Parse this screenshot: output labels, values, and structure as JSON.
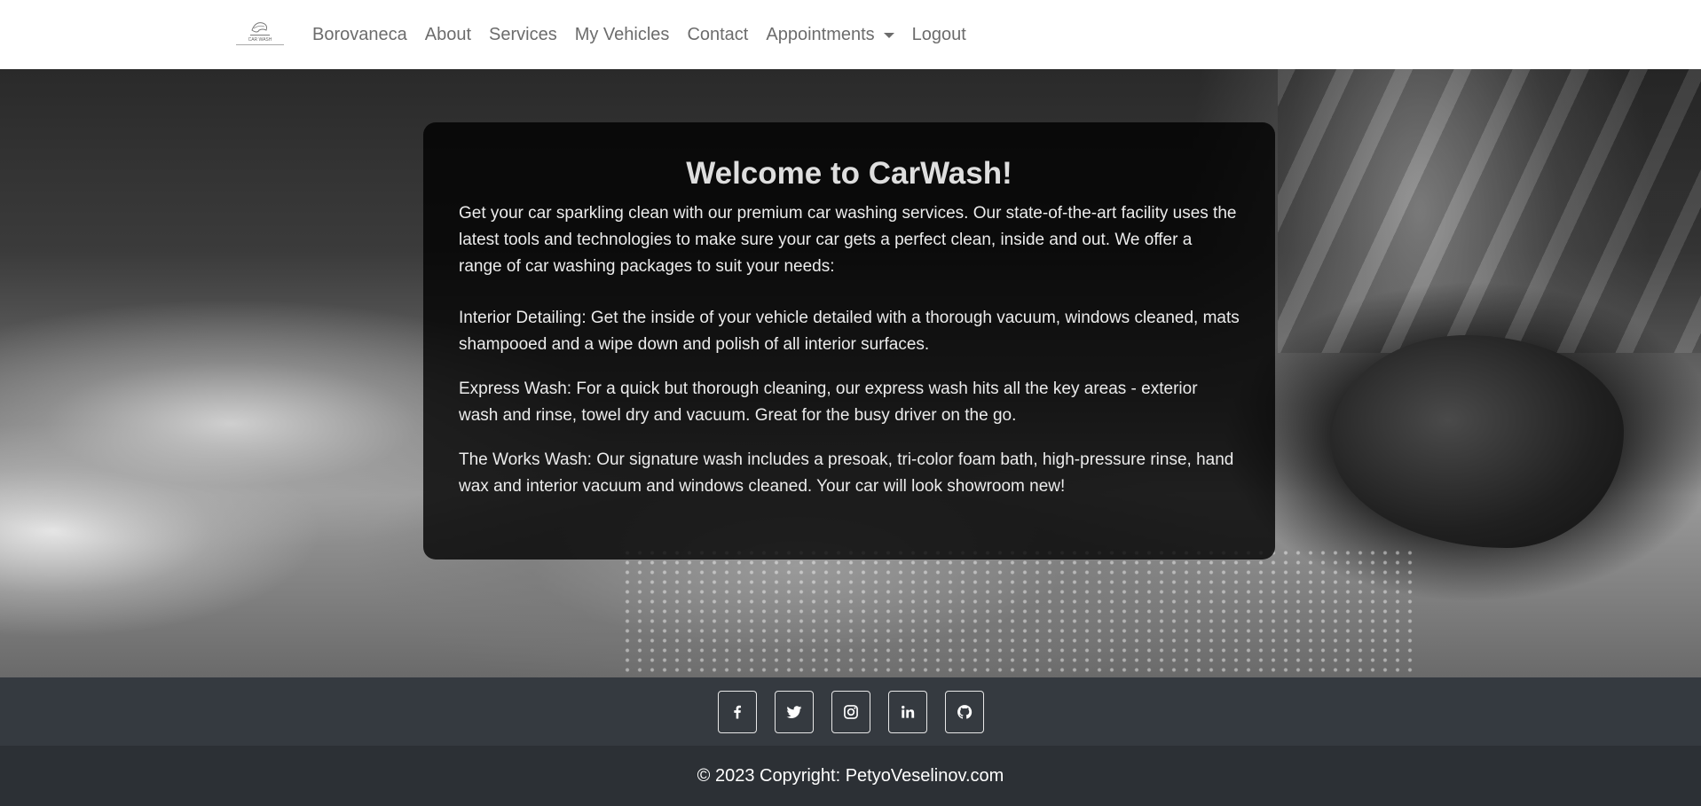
{
  "nav": {
    "brand_logo_text": "CAR WASH",
    "items": [
      {
        "label": "Borovaneca"
      },
      {
        "label": "About"
      },
      {
        "label": "Services"
      },
      {
        "label": "My Vehicles"
      },
      {
        "label": "Contact"
      },
      {
        "label": "Appointments"
      },
      {
        "label": "Logout"
      }
    ]
  },
  "hero": {
    "title": "Welcome to CarWash!",
    "intro": "Get your car sparkling clean with our premium car washing services. Our state-of-the-art facility uses the latest tools and technologies to make sure your car gets a perfect clean, inside and out. We offer a range of car washing packages to suit your needs:",
    "services": [
      {
        "text": "Interior Detailing: Get the inside of your vehicle detailed with a thorough vacuum, windows cleaned, mats shampooed and a wipe down and polish of all interior surfaces."
      },
      {
        "text": "Express Wash: For a quick but thorough cleaning, our express wash hits all the key areas - exterior wash and rinse, towel dry and vacuum. Great for the busy driver on the go."
      },
      {
        "text": "The Works Wash: Our signature wash includes a presoak, tri-color foam bath, high-pressure rinse, hand wax and interior vacuum and windows cleaned. Your car will look showroom new!"
      }
    ]
  },
  "social": {
    "icons": [
      "facebook-icon",
      "twitter-icon",
      "instagram-icon",
      "linkedin-icon",
      "github-icon"
    ]
  },
  "footer": {
    "copyright": "© 2023 Copyright: PetyoVeselinov.com"
  },
  "colors": {
    "navbar_bg": "#ffffff",
    "nav_text": "#6c6c6c",
    "social_bar_bg": "#353a40",
    "footer_bg": "#2c3035"
  }
}
